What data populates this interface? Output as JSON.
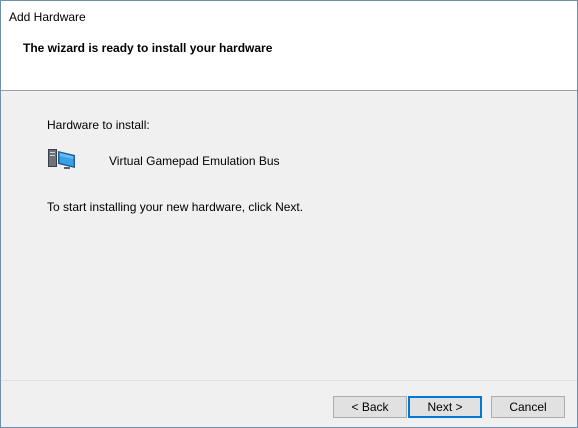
{
  "window": {
    "title": "Add Hardware"
  },
  "header": {
    "heading": "The wizard is ready to install your hardware"
  },
  "content": {
    "hardware_label": "Hardware to install:",
    "hardware_icon": "computer-hardware-icon",
    "hardware_name": "Virtual Gamepad Emulation Bus",
    "instruction": "To start installing your new hardware, click Next."
  },
  "buttons": {
    "back": "< Back",
    "next": "Next >",
    "cancel": "Cancel"
  },
  "colors": {
    "accent": "#0078d7",
    "background": "#f0f0f0",
    "header_background": "#ffffff"
  }
}
